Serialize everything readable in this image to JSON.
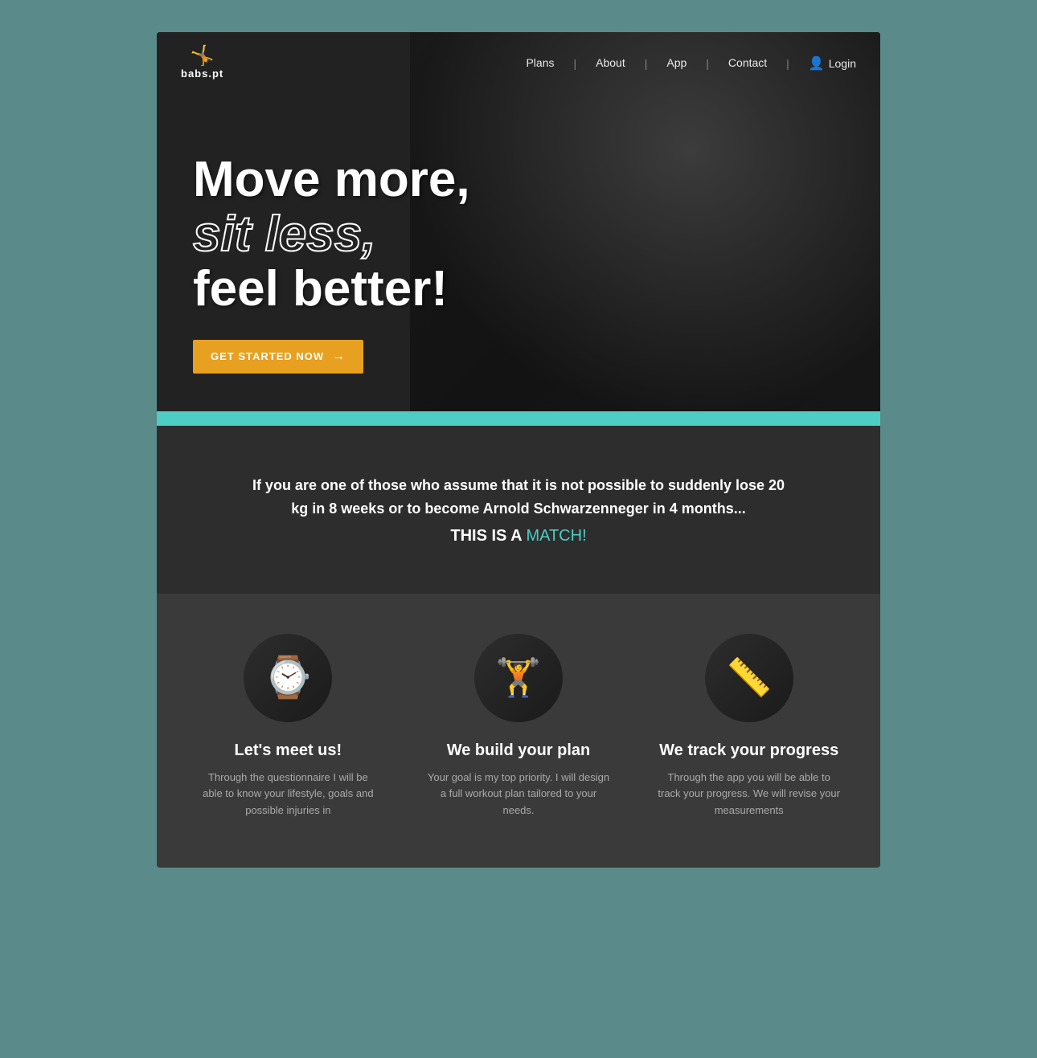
{
  "site": {
    "logo_icon": "🤸",
    "logo_text": "babs.pt"
  },
  "nav": {
    "items": [
      {
        "label": "Plans",
        "href": "#plans"
      },
      {
        "label": "About",
        "href": "#about"
      },
      {
        "label": "App",
        "href": "#app"
      },
      {
        "label": "Contact",
        "href": "#contact"
      }
    ],
    "login_label": "Login",
    "login_icon": "👤"
  },
  "hero": {
    "line1": "Move more,",
    "line2": "sit less,",
    "line3": "feel better!",
    "cta_label": "GET STARTED NOW",
    "cta_arrow": "→"
  },
  "quote": {
    "text": "If you are one of those who assume that it is not possible to suddenly lose 20 kg in 8 weeks or to become Arnold Schwarzenneger in 4 months...",
    "match_prefix": "THIS IS A ",
    "match_highlight": "MATCH!"
  },
  "features": [
    {
      "icon_type": "watch",
      "icon_emoji": "⌚",
      "title": "Let's meet us!",
      "description": "Through the questionnaire I will be able to know your lifestyle, goals and possible injuries in"
    },
    {
      "icon_type": "dumbbell",
      "icon_emoji": "🏋",
      "title": "We build your plan",
      "description": "Your goal is my top priority. I will design a full workout plan tailored to your needs."
    },
    {
      "icon_type": "tape",
      "icon_emoji": "📏",
      "title": "We track your progress",
      "description": "Through the app you will be able to track your progress. We will revise your measurements"
    }
  ],
  "colors": {
    "teal": "#4ecdc4",
    "dark_bg": "#2d2d2d",
    "darker_bg": "#3a3a3a",
    "gold": "#e8a020",
    "text_white": "#ffffff",
    "text_muted": "#aaaaaa"
  }
}
